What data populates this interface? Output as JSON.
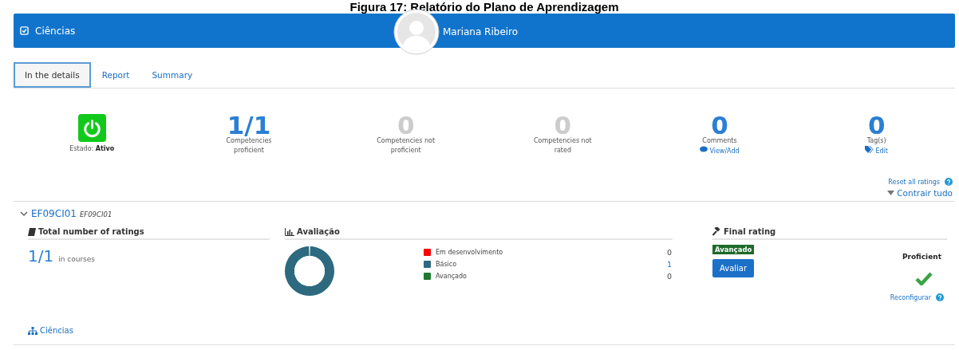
{
  "caption": "Figura 17: Relatório do Plano de Aprendizagem",
  "header": {
    "course": "Ciências",
    "user": "Mariana Ribeiro"
  },
  "tabs": [
    {
      "label": "In the details",
      "selected": true
    },
    {
      "label": "Report",
      "selected": false
    },
    {
      "label": "Summary",
      "selected": false
    }
  ],
  "stats": [
    {
      "kind": "status",
      "label": "Estado:",
      "value": "Ativo",
      "on": true
    },
    {
      "kind": "number",
      "value": "1/1",
      "label": "Competencies proficient",
      "muted": false
    },
    {
      "kind": "number",
      "value": "0",
      "label": "Competencies not proficient",
      "muted": true
    },
    {
      "kind": "number",
      "value": "0",
      "label": "Competencies not rated",
      "muted": true
    },
    {
      "kind": "comments",
      "value": "0",
      "label": "Comments",
      "muted": false,
      "link": "View/Add"
    },
    {
      "kind": "tags",
      "value": "0",
      "label": "Tag(s)",
      "muted": false,
      "link": "Edit"
    }
  ],
  "reset_link": "Reset all ratings",
  "collapse_link": "Contrair tudo",
  "competency": {
    "code": "EF09CI01",
    "idnumber": "EF09CI01",
    "expanded": true,
    "total": {
      "title": "Total number of ratings",
      "value": "1/1",
      "suffix": "in courses"
    },
    "evaluation": {
      "title": "Avaliação",
      "legend": [
        {
          "color": "#ff0000",
          "count": "0",
          "highlight": false
        },
        {
          "color": "#2d6a7f",
          "count": "1",
          "highlight": true
        },
        {
          "color": "#1e7a2e",
          "count": "0",
          "highlight": false
        }
      ],
      "chart_data": {
        "type": "donut",
        "categories": [
          "Em desenvolvimento",
          "Básico",
          "Avançado"
        ],
        "values": [
          0,
          1,
          0
        ]
      }
    },
    "final": {
      "title": "Final rating",
      "badge": "Avançado",
      "button": "Avaliar",
      "result": "Proficient",
      "proficient": true,
      "reconfigure": "Reconfigurar"
    },
    "framework_link": "Ciências"
  }
}
